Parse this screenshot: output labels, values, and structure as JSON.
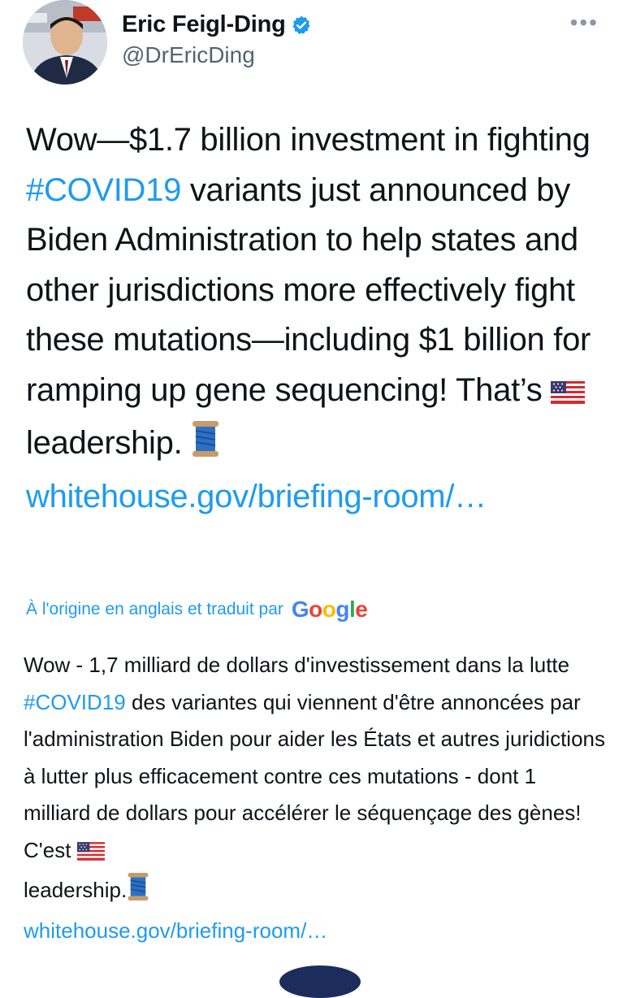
{
  "author": {
    "display_name": "Eric Feigl-Ding",
    "handle": "@DrEricDing"
  },
  "icons": {
    "verified": "verified-badge-icon",
    "more": "more-options-icon",
    "flag": "us-flag-emoji",
    "thread": "thread-spool-emoji"
  },
  "colors": {
    "link": "#1d9bf0",
    "text": "#0f1419",
    "muted": "#536471"
  },
  "tweet": {
    "part1": "Wow—$1.7 billion investment in fighting ",
    "hashtag": "#COVID19",
    "part2": " variants just announced by Biden Administration to help states and other jurisdictions more effectively fight these mutations—including $1 billion for ramping up gene sequencing! That’s ",
    "part3": " leadership. ",
    "link": "whitehouse.gov/briefing-room/…"
  },
  "translation_notice": {
    "label": "À l'origine en anglais et traduit par",
    "provider": "Google"
  },
  "translation": {
    "part1": "Wow - 1,7 milliard de dollars d'investissement dans la lutte ",
    "hashtag": "#COVID19",
    "part2": " des variantes qui viennent d'être annoncées par l'administration Biden pour aider les États et autres juridictions à lutter plus efficacement contre ces mutations - dont 1 milliard de dollars pour accélérer le séquençage des gènes! C'est ",
    "part3": " leadership.",
    "link": "whitehouse.gov/briefing-room/…"
  }
}
